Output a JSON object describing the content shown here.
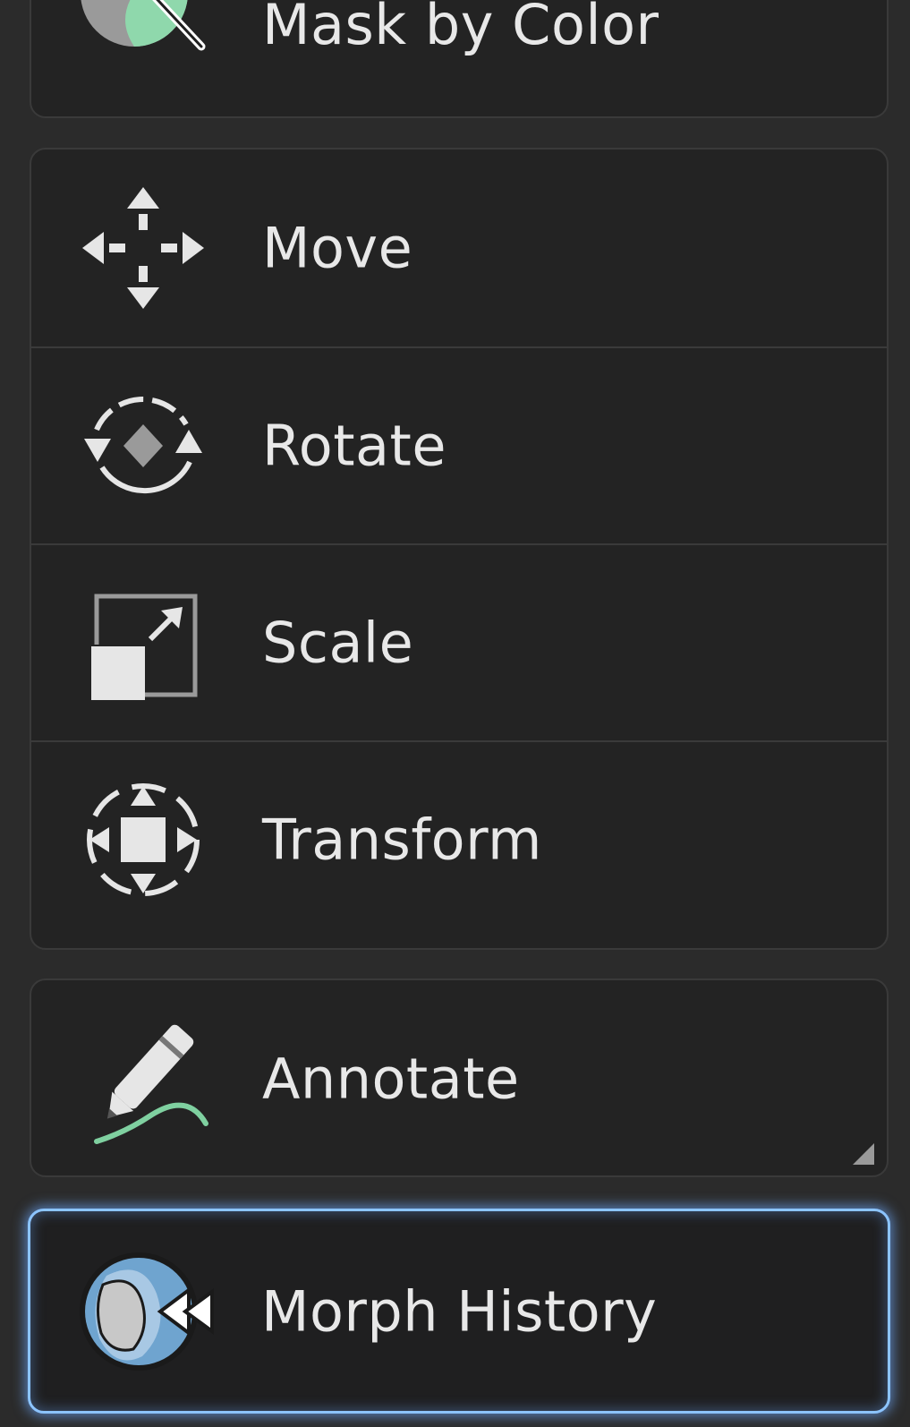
{
  "tools": {
    "mask_by_color": {
      "label": "Mask by Color",
      "icon": "magic-wand-color-icon"
    },
    "move": {
      "label": "Move",
      "icon": "move-arrows-icon"
    },
    "rotate": {
      "label": "Rotate",
      "icon": "rotate-icon"
    },
    "scale": {
      "label": "Scale",
      "icon": "scale-icon"
    },
    "transform": {
      "label": "Transform",
      "icon": "transform-icon"
    },
    "annotate": {
      "label": "Annotate",
      "icon": "pen-icon"
    },
    "morph_history": {
      "label": "Morph History",
      "icon": "morph-history-icon",
      "selected": true
    }
  },
  "colors": {
    "background": "#2b2b2b",
    "panel": "#232323",
    "text": "#e8e8e8",
    "accent_green": "#7fd0a0",
    "accent_blue": "#8cc4ff"
  }
}
